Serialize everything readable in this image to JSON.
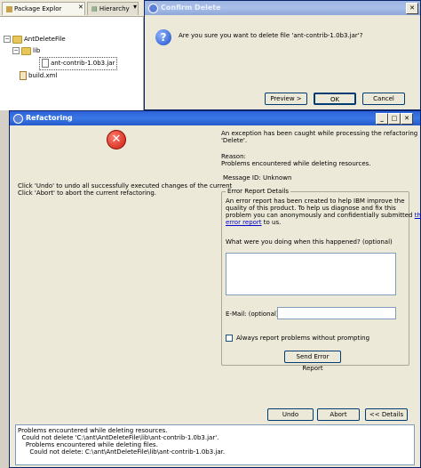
{
  "package_explorer": {
    "tabs": [
      {
        "label": "Package Explor"
      },
      {
        "label": "Hierarchy"
      }
    ],
    "tree": [
      {
        "label": "AntDeleteFile"
      },
      {
        "label": "lib"
      },
      {
        "label": "ant-contrib-1.0b3.jar"
      },
      {
        "label": "build.xml"
      }
    ]
  },
  "confirm_dialog": {
    "title": "Confirm Delete",
    "message": "Are you sure you want to delete file 'ant-contrib-1.0b3.jar'?",
    "buttons": {
      "preview": "Preview >",
      "ok": "OK",
      "cancel": "Cancel"
    }
  },
  "refactoring_dialog": {
    "title": "Refactoring",
    "instructions": [
      "Click 'Undo' to undo all successfully executed changes of the current",
      "Click 'Abort' to abort the current refactoring."
    ],
    "exception_lines": [
      "An exception has been caught while processing the refactoring",
      "'Delete'."
    ],
    "reason_label": "Reason:",
    "reason_text": "Problems encountered while deleting resources.",
    "message_id": "Message ID: Unknown",
    "error_report": {
      "group_label": "Error Report Details",
      "lines": [
        "An error report has been created to help IBM improve the",
        "quality of this product. To help us diagnose and fix this",
        "problem you can anonymously and confidentially submitted "
      ],
      "link_part1": "this",
      "link_part2": "error report",
      "after_link": " to us.",
      "question": "What were you doing when this happened? (optional)",
      "email_label": "E-Mail: (optional)",
      "always_label": "Always report problems without prompting",
      "send_button": "Send Error Report"
    },
    "buttons": {
      "undo": "Undo",
      "abort": "Abort",
      "details": "<< Details"
    },
    "details_lines": [
      "Problems encountered while deleting resources.",
      "  Could not delete 'C:\\ant\\AntDeleteFile\\lib\\ant-contrib-1.0b3.jar'.",
      "    Problems encountered while deleting files.",
      "      Could not delete: C:\\ant\\AntDeleteFile\\lib\\ant-contrib-1.0b3.jar."
    ]
  }
}
